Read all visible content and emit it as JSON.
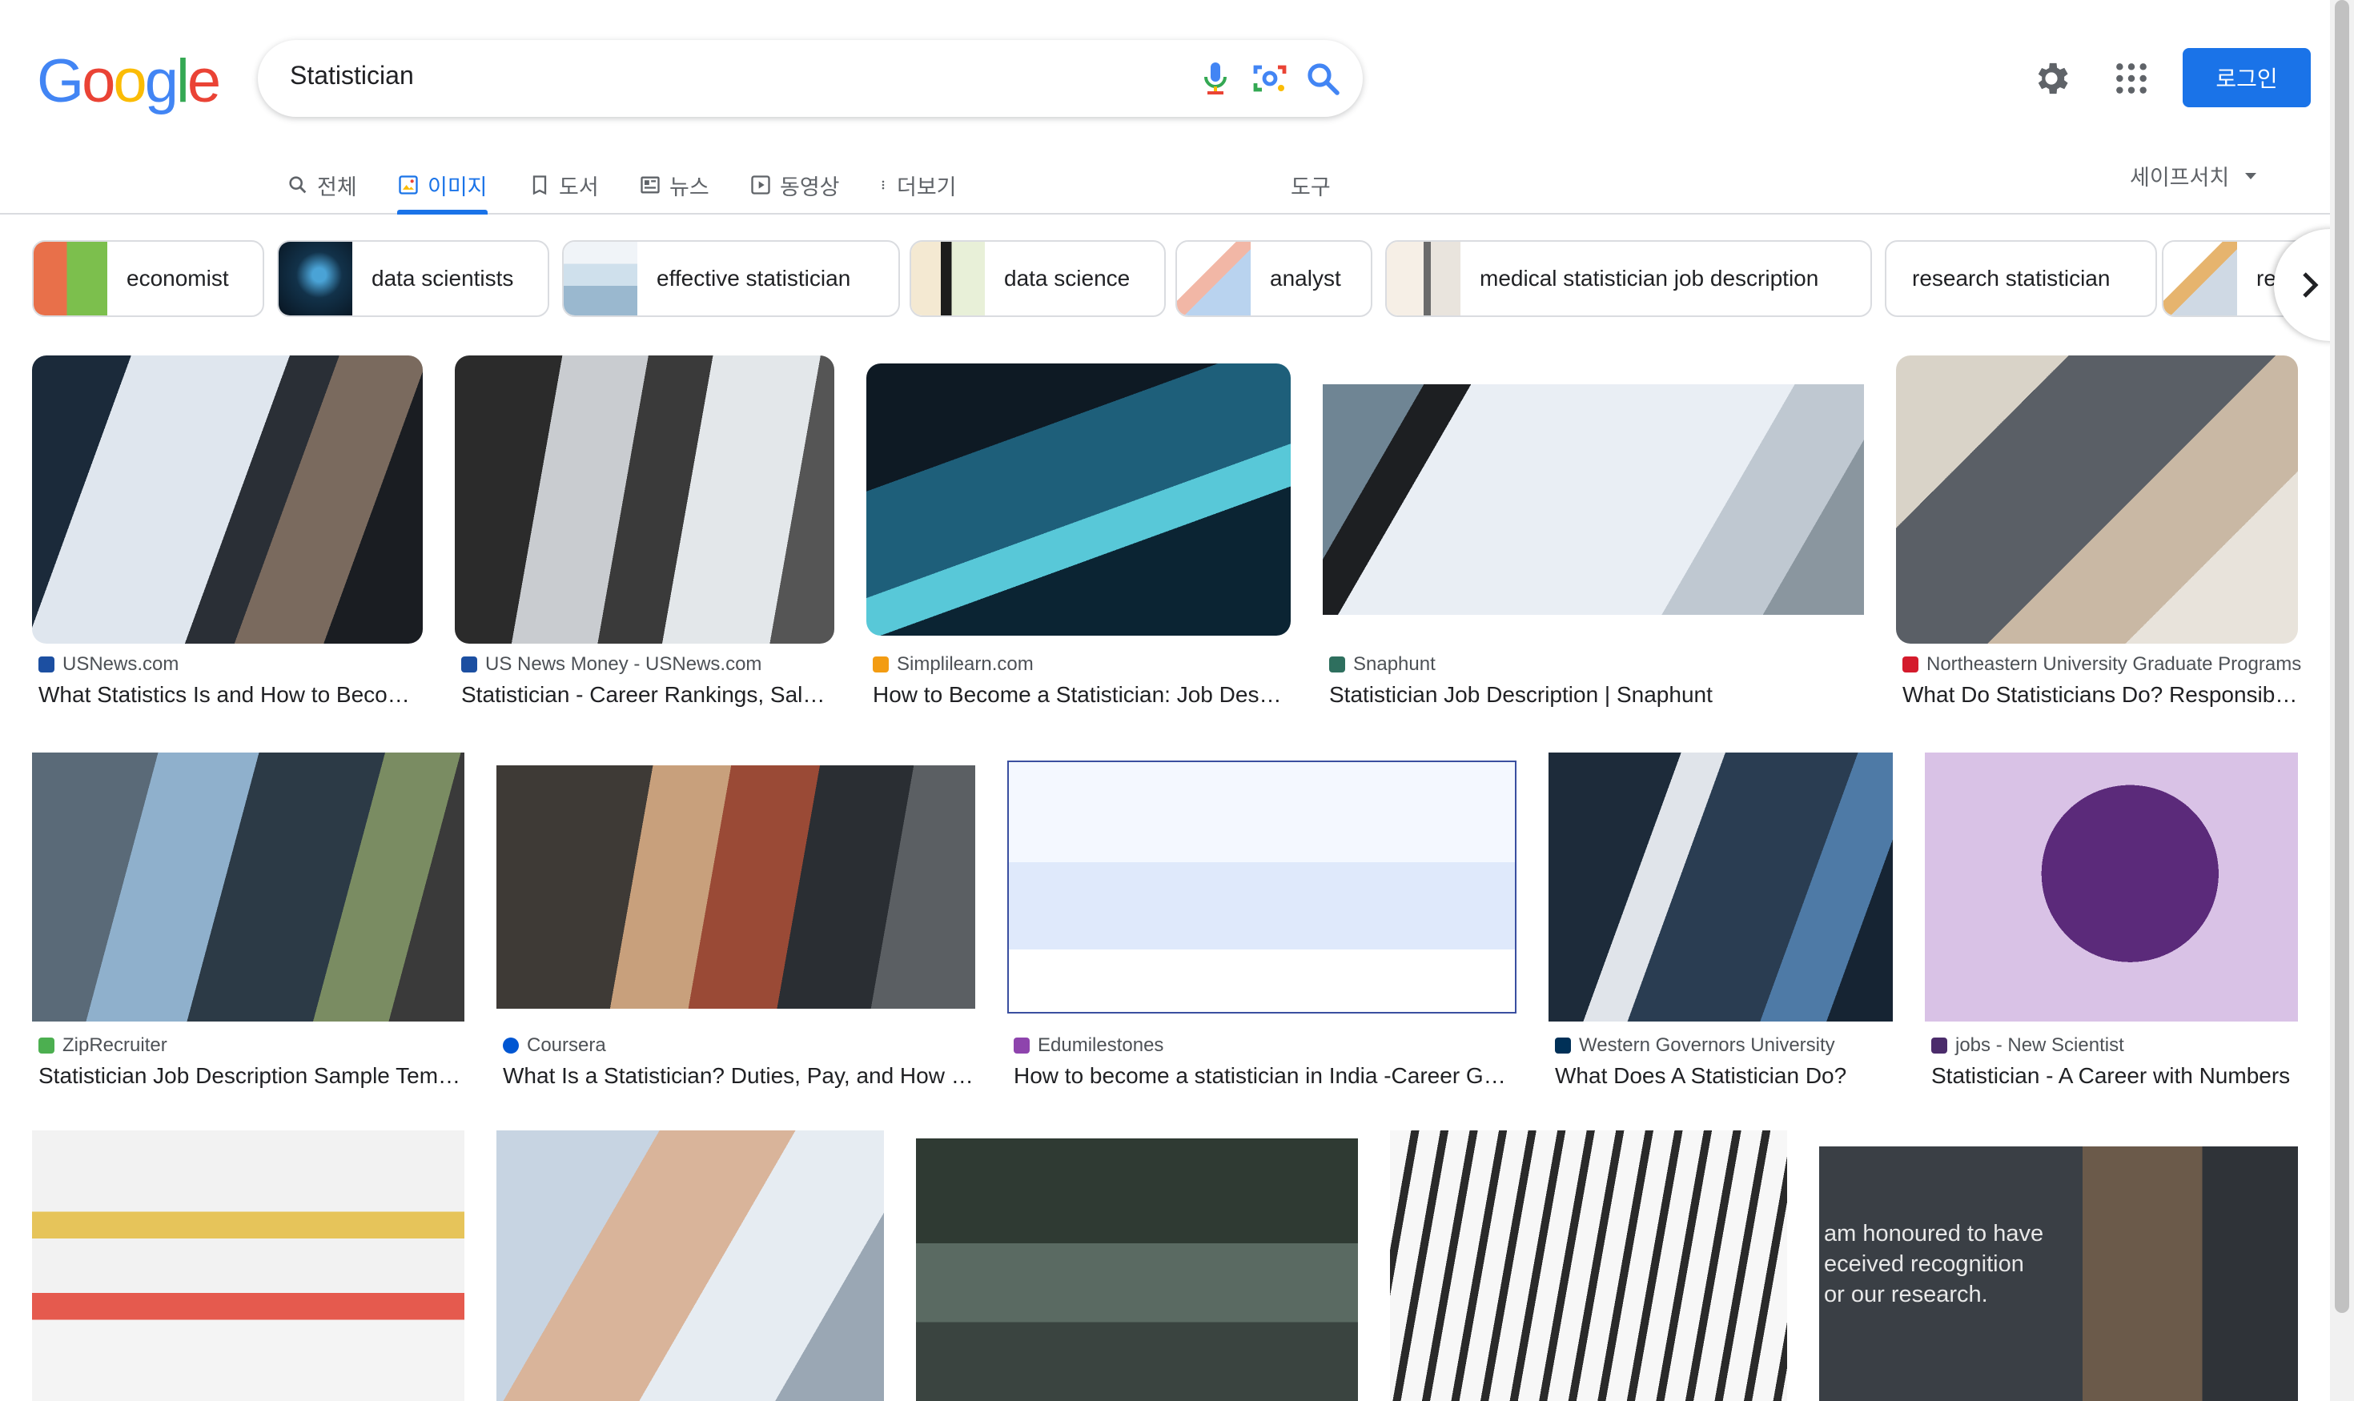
{
  "logo": "Google",
  "search": {
    "query": "Statistician"
  },
  "header": {
    "login_label": "로그인"
  },
  "tabs": [
    {
      "label": "전체",
      "icon": "search-icon"
    },
    {
      "label": "이미지",
      "icon": "image-icon",
      "active": true
    },
    {
      "label": "도서",
      "icon": "book-icon"
    },
    {
      "label": "뉴스",
      "icon": "news-icon"
    },
    {
      "label": "동영상",
      "icon": "video-icon"
    },
    {
      "label": "더보기",
      "icon": "more-icon"
    }
  ],
  "tools_label": "도구",
  "safesearch_label": "세이프서치",
  "chips": [
    {
      "label": "economist"
    },
    {
      "label": "data scientists"
    },
    {
      "label": "effective statistician"
    },
    {
      "label": "data science"
    },
    {
      "label": "analyst"
    },
    {
      "label": "medical statistician job description"
    },
    {
      "label": "research statistician"
    },
    {
      "label": "re"
    }
  ],
  "results": [
    {
      "source": "USNews.com",
      "title": "What Statistics Is and How to Become a Statistician"
    },
    {
      "source": "US News Money - USNews.com",
      "title": "Statistician - Career Rankings, Salary, Reviews"
    },
    {
      "source": "Simplilearn.com",
      "title": "How to Become a Statistician: Job Description"
    },
    {
      "source": "Snaphunt",
      "title": "Statistician Job Description | Snaphunt"
    },
    {
      "source": "Northeastern University Graduate Programs",
      "title": "What Do Statisticians Do? Responsibilities"
    },
    {
      "source": "ZipRecruiter",
      "title": "Statistician Job Description Sample Template"
    },
    {
      "source": "Coursera",
      "title": "What Is a Statistician? Duties, Pay, and How to Become One"
    },
    {
      "source": "Edumilestones",
      "title": "How to become a statistician in India -Career Guide"
    },
    {
      "source": "Western Governors University",
      "title": "What Does A Statistician Do?"
    },
    {
      "source": "jobs - New Scientist",
      "title": "Statistician - A Career with Numbers"
    },
    {
      "source": "",
      "title": ""
    },
    {
      "source": "",
      "title": ""
    },
    {
      "source": "",
      "title": ""
    },
    {
      "source": "",
      "title": ""
    },
    {
      "source": "",
      "title": ""
    }
  ],
  "overlay_text": {
    "line1": "am honoured to have",
    "line2": "eceived recognition",
    "line3": "or our research."
  },
  "colors": {
    "accent": "#1a73e8",
    "text": "#202124",
    "muted": "#5f6368",
    "border": "#dadce0"
  }
}
